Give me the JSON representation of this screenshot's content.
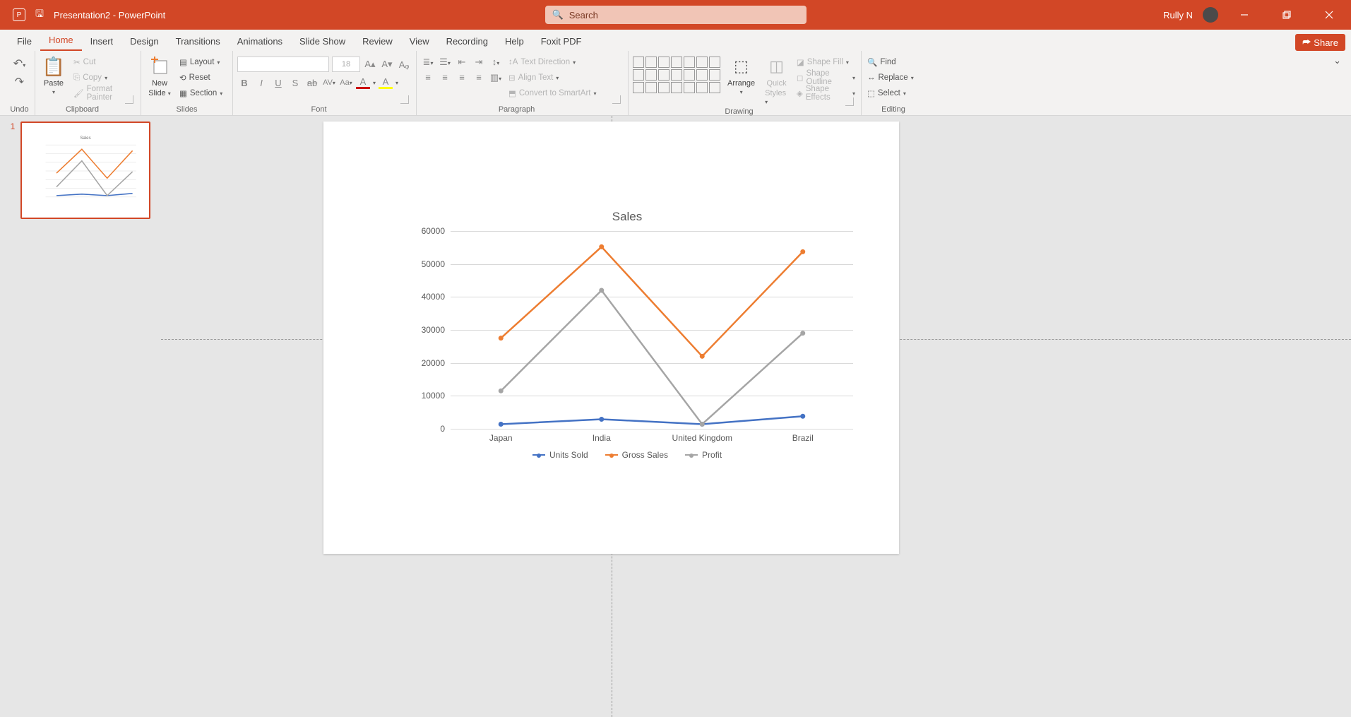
{
  "titlebar": {
    "doc_name": "Presentation2",
    "app_suffix": "  -  PowerPoint",
    "search_placeholder": "Search",
    "user_name": "Rully N"
  },
  "tabs": {
    "items": [
      "File",
      "Home",
      "Insert",
      "Design",
      "Transitions",
      "Animations",
      "Slide Show",
      "Review",
      "View",
      "Recording",
      "Help",
      "Foxit PDF"
    ],
    "active_index": 1,
    "share_label": "Share"
  },
  "ribbon": {
    "undo_label": "Undo",
    "clipboard": {
      "paste": "Paste",
      "cut": "Cut",
      "copy": "Copy",
      "format_painter": "Format Painter",
      "label": "Clipboard"
    },
    "slides": {
      "new_slide_l1": "New",
      "new_slide_l2": "Slide",
      "layout": "Layout",
      "reset": "Reset",
      "section": "Section",
      "label": "Slides"
    },
    "font": {
      "size": "18",
      "label": "Font"
    },
    "paragraph": {
      "text_direction": "Text Direction",
      "align_text": "Align Text",
      "smartart": "Convert to SmartArt",
      "label": "Paragraph"
    },
    "drawing": {
      "arrange": "Arrange",
      "quick_l1": "Quick",
      "quick_l2": "Styles",
      "shape_fill": "Shape Fill",
      "shape_outline": "Shape Outline",
      "shape_effects": "Shape Effects",
      "label": "Drawing"
    },
    "editing": {
      "find": "Find",
      "replace": "Replace",
      "select": "Select",
      "label": "Editing"
    }
  },
  "thumbs": {
    "first_index": "1"
  },
  "chart_data": {
    "type": "line",
    "title": "Sales",
    "xlabel": "",
    "ylabel": "",
    "ylim": [
      0,
      60000
    ],
    "yticks": [
      0,
      10000,
      20000,
      30000,
      40000,
      50000,
      60000
    ],
    "categories": [
      "Japan",
      "India",
      "United Kingdom",
      "Brazil"
    ],
    "series": [
      {
        "name": "Units Sold",
        "color": "#4472c4",
        "values": [
          1400,
          2900,
          1400,
          3800
        ]
      },
      {
        "name": "Gross Sales",
        "color": "#ed7d31",
        "values": [
          27500,
          55200,
          22000,
          53700
        ]
      },
      {
        "name": "Profit",
        "color": "#a5a5a5",
        "values": [
          11500,
          42000,
          1400,
          29000
        ]
      }
    ]
  }
}
